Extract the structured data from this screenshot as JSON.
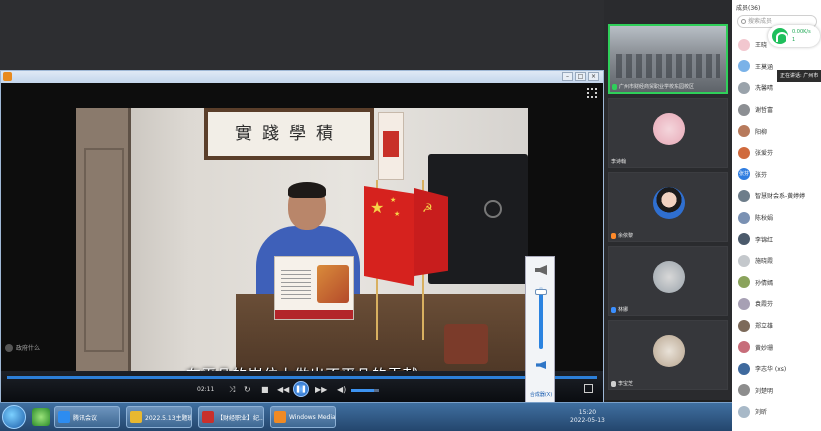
{
  "player": {
    "subtitle": "在平凡的岗位上做出不平凡的贡献",
    "calligraphy": "實踐學積",
    "time": "02:11",
    "sidebar_text": "政府什么",
    "volume_mixer_label": "合成器(X)",
    "win_buttons": [
      "–",
      "□",
      "×"
    ]
  },
  "tiles": [
    {
      "name": "广州市财经商贸职业学校东园校区",
      "mic": "green"
    },
    {
      "name": "李诗翰",
      "mic": "none"
    },
    {
      "name": "余依黎",
      "mic": "orange"
    },
    {
      "name": "林娜",
      "mic": "blue"
    },
    {
      "name": "李宝芝",
      "mic": "none"
    }
  ],
  "members": {
    "header": "成员(36)",
    "search_placeholder": "搜索成员",
    "speaking_label": "正在讲话: 广州市",
    "network": {
      "speed": "0.00K/s",
      "count": "1"
    },
    "list": [
      {
        "name": "王晓",
        "color": "#f2c7cf"
      },
      {
        "name": "王莫涵",
        "color": "#7ab2e8"
      },
      {
        "name": "冼馨晴",
        "color": "#9aa3ab"
      },
      {
        "name": "谢哲富",
        "color": "#8c8f93"
      },
      {
        "name": "阳柳",
        "color": "#b77a5c"
      },
      {
        "name": "张爱芬",
        "color": "#d06a3d"
      },
      {
        "name": "张芬",
        "color": "#2f7de0",
        "badge": "张芬"
      },
      {
        "name": "智慧财会系-黄婷婷",
        "color": "#6d7d8a"
      },
      {
        "name": "陈秋娟",
        "color": "#7a91b3"
      },
      {
        "name": "李锦红",
        "color": "#4b5a6b"
      },
      {
        "name": "施晓霞",
        "color": "#c4c8cc"
      },
      {
        "name": "孙倩嫣",
        "color": "#8aa35c"
      },
      {
        "name": "袁霞芬",
        "color": "#a7a0b4"
      },
      {
        "name": "郑立雄",
        "color": "#7c6a5a"
      },
      {
        "name": "黄妙珊",
        "color": "#c76d7a"
      },
      {
        "name": "李志华 (xs)",
        "color": "#3f6a9e"
      },
      {
        "name": "刘楚明",
        "color": "#8d8d8d"
      },
      {
        "name": "刘昕",
        "color": "#a8b9c8"
      }
    ]
  },
  "taskbar": {
    "items": [
      {
        "label": "腾讯会议",
        "color": "#2d8cf0"
      },
      {
        "label": "2022.5.13主题班日",
        "color": "#e8b830"
      },
      {
        "label": "【财经职业】纪...",
        "color": "#c9302c"
      },
      {
        "label": "Windows Media...",
        "color": "#f08a24"
      }
    ],
    "clock_time": "15:20",
    "clock_date": "2022-05-13"
  }
}
